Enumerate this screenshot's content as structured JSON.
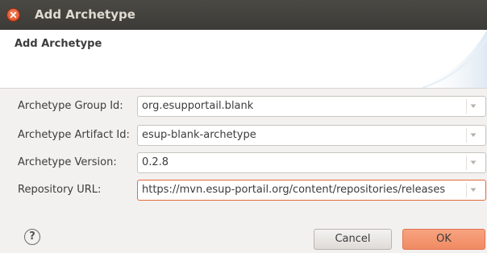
{
  "window": {
    "title": "Add Archetype"
  },
  "banner": {
    "title": "Add Archetype"
  },
  "form": {
    "fields": [
      {
        "label": "Archetype Group Id:",
        "value": "org.esupportail.blank"
      },
      {
        "label": "Archetype Artifact Id:",
        "value": "esup-blank-archetype"
      },
      {
        "label": "Archetype Version:",
        "value": "0.2.8"
      },
      {
        "label": "Repository URL:",
        "value": "https://mvn.esup-portail.org/content/repositories/releases"
      }
    ]
  },
  "buttons": {
    "help": "?",
    "cancel": "Cancel",
    "ok": "OK"
  },
  "icons": {
    "close": "close-icon",
    "dropdown": "chevron-down-icon",
    "help": "help-icon"
  },
  "colors": {
    "titlebar": "#3c3b37",
    "close_button": "#e2552c",
    "ok_button": "#f08a62",
    "focus_border": "#e66a3c"
  }
}
